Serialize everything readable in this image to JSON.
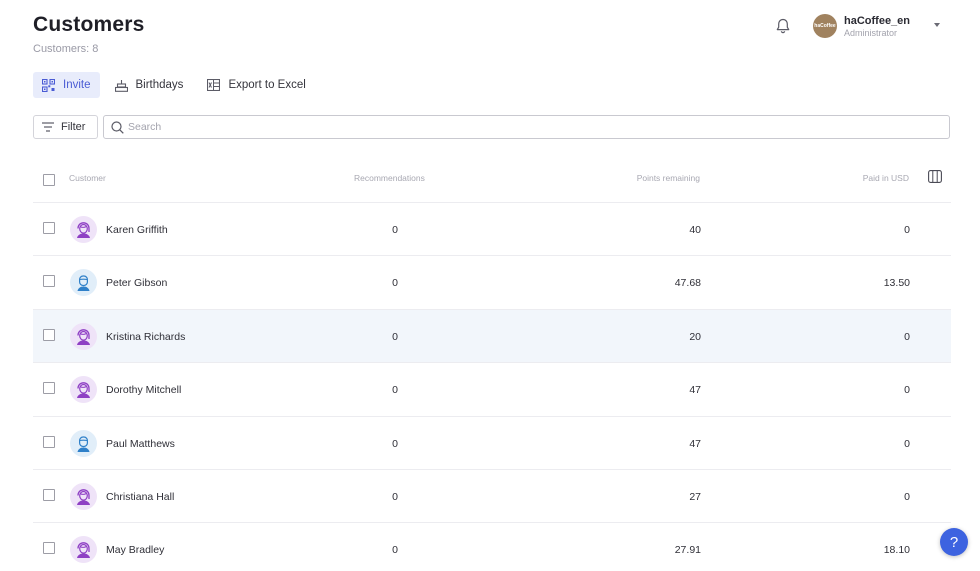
{
  "page": {
    "title": "Customers",
    "subtitle": "Customers: 8"
  },
  "user": {
    "name": "haCoffee_en",
    "role": "Administrator",
    "logo_text": "haCoffee"
  },
  "toolbar": {
    "invite_label": "Invite",
    "birthdays_label": "Birthdays",
    "export_label": "Export to Excel"
  },
  "filter": {
    "label": "Filter"
  },
  "search": {
    "placeholder": "Search",
    "value": ""
  },
  "table": {
    "columns": [
      "Customer",
      "Recommendations",
      "Points remaining",
      "Paid in USD"
    ],
    "rows": [
      {
        "name": "Karen Griffith",
        "recommendations": "0",
        "points": "40",
        "paid": "0",
        "avatar": "female-avatar-icon"
      },
      {
        "name": "Peter Gibson",
        "recommendations": "0",
        "points": "47.68",
        "paid": "13.50",
        "avatar": "male-avatar-icon"
      },
      {
        "name": "Kristina Richards",
        "recommendations": "0",
        "points": "20",
        "paid": "0",
        "avatar": "female-avatar-icon"
      },
      {
        "name": "Dorothy Mitchell",
        "recommendations": "0",
        "points": "47",
        "paid": "0",
        "avatar": "female-avatar-icon"
      },
      {
        "name": "Paul Matthews",
        "recommendations": "0",
        "points": "47",
        "paid": "0",
        "avatar": "male-avatar-icon"
      },
      {
        "name": "Christiana Hall",
        "recommendations": "0",
        "points": "27",
        "paid": "0",
        "avatar": "female-avatar-icon"
      },
      {
        "name": "May Bradley",
        "recommendations": "0",
        "points": "27.91",
        "paid": "18.10",
        "avatar": "female-avatar-icon"
      }
    ]
  },
  "help": {
    "label": "?"
  },
  "colors": {
    "accent": "#4a5bd4",
    "active_tab_bg": "#e8ecfb",
    "help_button": "#3d63e0",
    "female_avatar": "#8e3fc4",
    "male_avatar": "#2f80c9",
    "highlight_row": "#f2f6fb"
  }
}
